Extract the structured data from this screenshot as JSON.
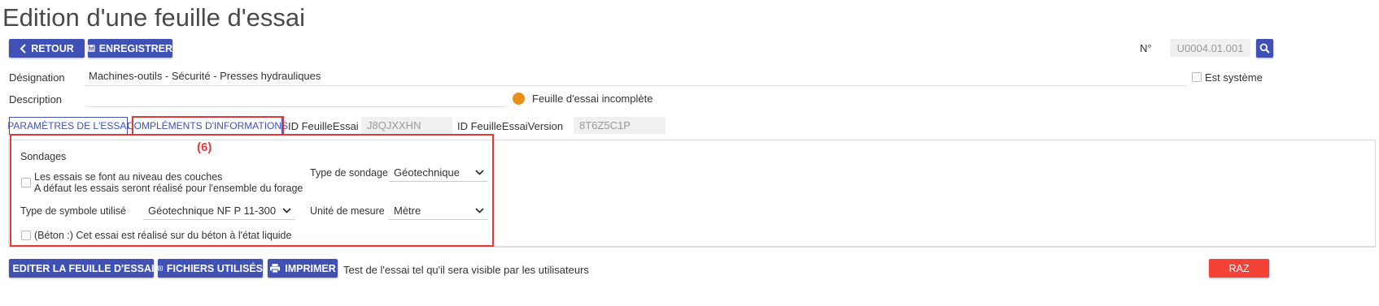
{
  "page": {
    "title": "Edition d'une feuille d'essai"
  },
  "toolbar": {
    "back_label": "RETOUR",
    "save_label": "ENREGISTRER"
  },
  "header": {
    "number_label": "N°",
    "number_value": "U0004.01.001"
  },
  "form": {
    "designation_label": "Désignation",
    "designation_value": "Machines-outils - Sécurité - Presses hydrauliques",
    "system_label": "Est système",
    "description_label": "Description",
    "description_value": "",
    "status_text": "Feuille d'essai incomplète",
    "status_color": "#e8901e"
  },
  "tabs": [
    {
      "label": "PARAMÈTRES DE L'ESSAI"
    },
    {
      "label": "COMPLÉMENTS D'INFORMATIONS"
    }
  ],
  "ids": {
    "feuille_label": "ID FeuilleEssai",
    "feuille_value": "J8QJXXHN",
    "version_label": "ID FeuilleEssaiVersion",
    "version_value": "8T6Z5C1P"
  },
  "annotation": "(6)",
  "sondages": {
    "heading": "Sondages",
    "layers_line1": "Les essais se font au niveau des couches",
    "layers_line2": "A défaut les essais seront réalisé pour l'ensemble du forage",
    "type_sondage_label": "Type de sondage",
    "type_sondage_value": "Géotechnique",
    "symbol_label": "Type de symbole utilisé",
    "symbol_value": "Géotechnique NF P 11-300",
    "unit_label": "Unité de mesure",
    "unit_value": "Mètre",
    "beton_label": "(Béton :) Cet essai est réalisé sur du béton à l'état liquide"
  },
  "footer": {
    "edit_label": "EDITER LA FEUILLE D'ESSAI",
    "files_label": "FICHIERS UTILISÉS",
    "print_label": "IMPRIMER",
    "note": "Test de l'essai tel qu'il sera visible par les utilisateurs",
    "reset_label": "RAZ"
  },
  "colors": {
    "primary": "#3f51b5",
    "danger": "#f44336",
    "annotation": "#e53935"
  }
}
